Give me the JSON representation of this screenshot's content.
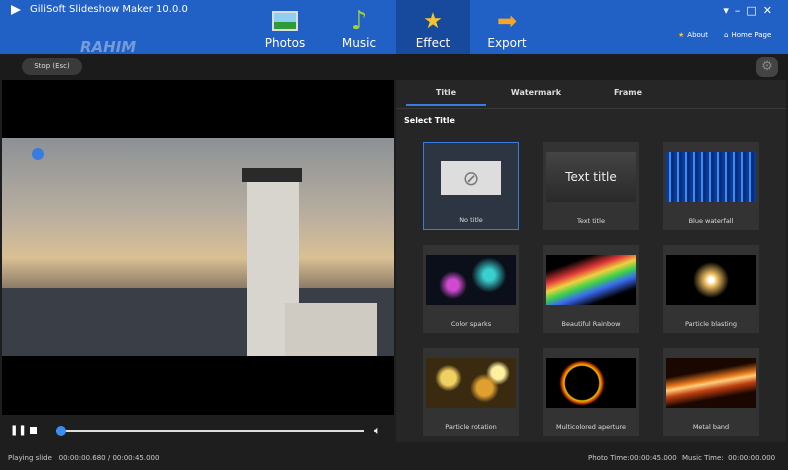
{
  "app": {
    "title": "GiliSoft Slideshow Maker 10.0.0",
    "watermark": "RAHIM SOFTWARES"
  },
  "nav": [
    {
      "label": "Photos"
    },
    {
      "label": "Music"
    },
    {
      "label": "Effect"
    },
    {
      "label": "Export"
    }
  ],
  "links": {
    "about": "About",
    "home": "Home Page"
  },
  "toolbar": {
    "stop": "Stop (Esc)"
  },
  "tabs": [
    {
      "label": "Title"
    },
    {
      "label": "Watermark"
    },
    {
      "label": "Frame"
    }
  ],
  "panel": {
    "heading": "Select Title"
  },
  "cards": [
    {
      "label": "No title"
    },
    {
      "label": "Text title",
      "thumb_text": "Text title"
    },
    {
      "label": "Blue waterfall"
    },
    {
      "label": "Color sparks"
    },
    {
      "label": "Beautiful Rainbow"
    },
    {
      "label": "Particle blasting"
    },
    {
      "label": "Particle rotation"
    },
    {
      "label": "Multicolored aperture"
    },
    {
      "label": "Metal band"
    }
  ],
  "player": {
    "progress": 0.015
  },
  "status": {
    "playing": "Playing slide   00:00:00.680 / 00:00:45.000",
    "photo_time": "Photo Time:00:00:45.000",
    "music_time": "Music Time:  00:00:00.000"
  }
}
